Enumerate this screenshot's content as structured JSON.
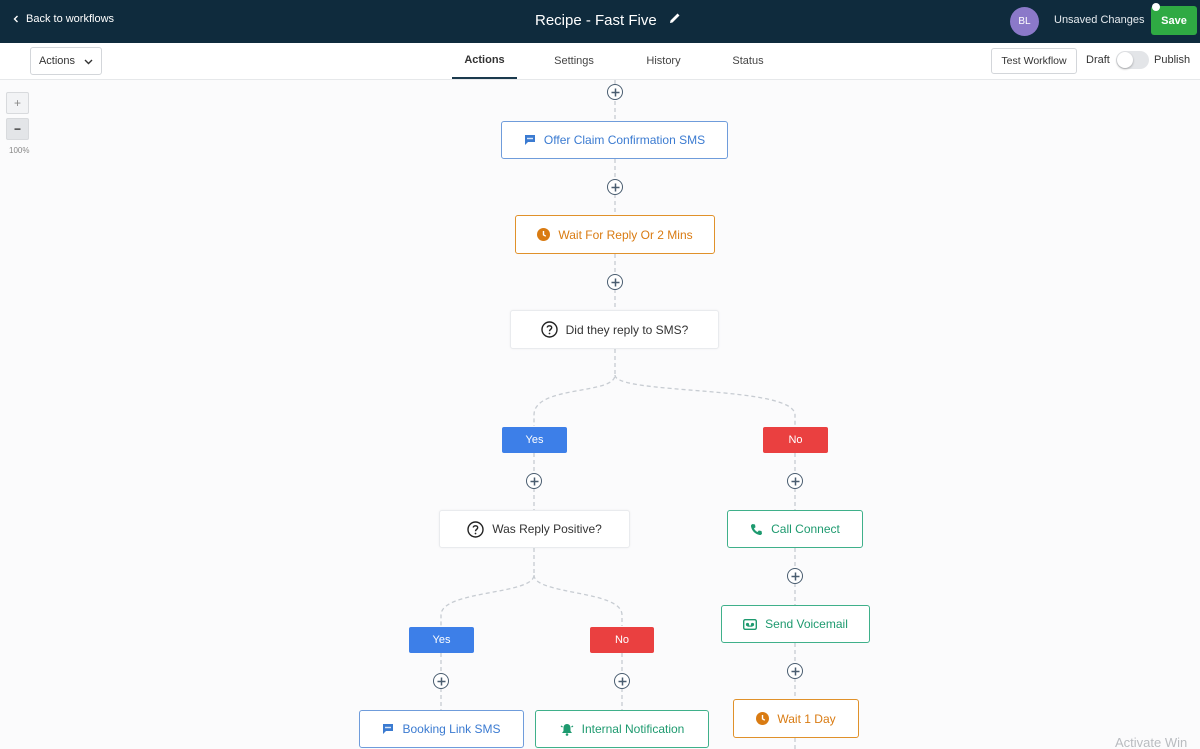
{
  "topbar": {
    "back_label": "Back to workflows",
    "title": "Recipe - Fast Five",
    "avatar_initials": "BL",
    "status_text": "Unsaved Changes",
    "save_label": "Save"
  },
  "subbar": {
    "actions_label": "Actions",
    "tabs": [
      {
        "label": "Actions",
        "active": true
      },
      {
        "label": "Settings",
        "active": false
      },
      {
        "label": "History",
        "active": false
      },
      {
        "label": "Status",
        "active": false
      }
    ],
    "test_label": "Test Workflow",
    "draft_label": "Draft",
    "publish_label": "Publish",
    "published": false
  },
  "zoom": {
    "in_label": "+",
    "out_label": "−",
    "level": "100%"
  },
  "workflow": {
    "nodes": {
      "offer_sms": {
        "label": "Offer Claim Confirmation SMS",
        "icon": "sms-icon"
      },
      "wait_reply": {
        "label": "Wait For Reply Or 2 Mins",
        "icon": "clock-icon"
      },
      "cond_replied": {
        "label": "Did they reply to SMS?",
        "icon": "question-icon"
      },
      "cond_positive": {
        "label": "Was Reply Positive?",
        "icon": "question-icon"
      },
      "call_connect": {
        "label": "Call Connect",
        "icon": "phone-icon"
      },
      "send_voicemail": {
        "label": "Send Voicemail",
        "icon": "voicemail-icon"
      },
      "wait_day": {
        "label": "Wait 1 Day",
        "icon": "clock-icon"
      },
      "booking_sms": {
        "label": "Booking Link SMS",
        "icon": "sms-icon"
      },
      "internal_notification": {
        "label": "Internal Notification",
        "icon": "bell-icon"
      }
    },
    "branches": {
      "replied_yes": "Yes",
      "replied_no": "No",
      "positive_yes": "Yes",
      "positive_no": "No"
    }
  },
  "colors": {
    "topbar": "#0f2b3d",
    "save": "#2faa43",
    "action_blue": "#3b7bd1",
    "wait_orange": "#d97b12",
    "call_green": "#1e9a6f",
    "yes": "#3d7fe8",
    "no": "#ea4040"
  },
  "watermark": "Activate Win"
}
